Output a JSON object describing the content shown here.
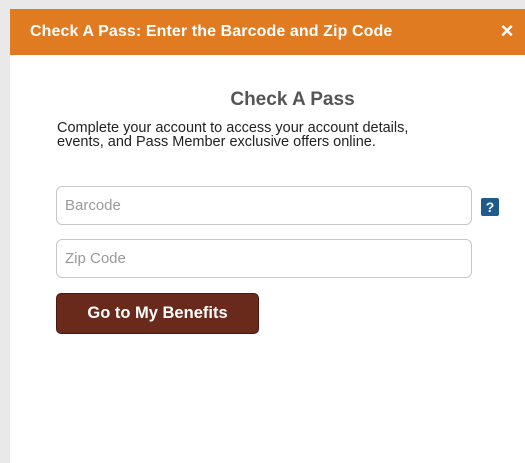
{
  "dialog": {
    "title": "Check A Pass: Enter the Barcode and Zip Code",
    "close_icon": "×"
  },
  "main": {
    "heading": "Check A Pass",
    "description": "Complete your account to access your account details, events, and Pass Member exclusive offers online.",
    "barcode_placeholder": "Barcode",
    "barcode_value": "",
    "zip_placeholder": "Zip Code",
    "zip_value": "",
    "help_icon": "?",
    "submit_label": "Go to My Benefits"
  },
  "colors": {
    "header": "#e07b22",
    "button": "#6a2a1b",
    "help_icon": "#1e5a8c"
  }
}
